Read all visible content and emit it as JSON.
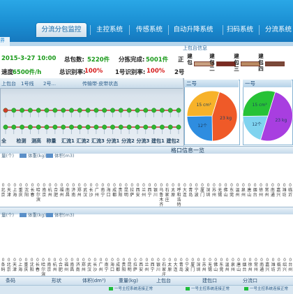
{
  "nav": {
    "tabs": [
      "分流分包监控",
      "主控系统",
      "传感系统",
      "自动升降系统",
      "扫码系统",
      "分流系统"
    ],
    "active_index": 0,
    "left_fragment": "界"
  },
  "stats": {
    "date": "2015-3-27 10:00",
    "total_label": "总包数:",
    "total_value": "5220件",
    "done_label": "分拣完成:",
    "done_value": "5001件",
    "speed_label": "速度",
    "speed_value": "6500件/h",
    "total_rate_label": "总识别率:",
    "total_rate_value": "100%",
    "one_rate_label": "1号识别率:",
    "one_rate_value": "100%",
    "right_frag1": "正",
    "right_frag2": "2号"
  },
  "upper_legend": {
    "head": "上包台信息",
    "labels": [
      "建包",
      "建包二",
      "建包三",
      "建包四"
    ],
    "colors": [
      "#c8a080",
      "#7a2b22",
      "#b98a62",
      "#7a4a3a"
    ]
  },
  "conveyor": {
    "tab_items": [
      "上包台",
      "1号线",
      "2号...",
      "传输带·皮带状态"
    ],
    "lane_labels": [
      "全",
      "检测",
      "测高",
      "称量",
      "汇流1",
      "汇流2",
      "汇流3",
      "分流1",
      "分流2",
      "分流3",
      "建包1",
      "建包2"
    ]
  },
  "pies": [
    {
      "title": "二号",
      "slices": [
        {
          "label": "23 kg",
          "value": 45,
          "color": "#ef5a28"
        },
        {
          "label": "12个",
          "value": 25,
          "color": "#2e8de0"
        },
        {
          "label": "15 cm³",
          "value": 30,
          "color": "#f7b22a"
        }
      ]
    },
    {
      "title": "一号",
      "slices": [
        {
          "label": "23 kg",
          "value": 50,
          "color": "#a83ee0"
        },
        {
          "label": "12个",
          "value": 20,
          "color": "#7fd3ef"
        },
        {
          "label": "15 cm³",
          "value": 30,
          "color": "#27c236"
        }
      ]
    }
  ],
  "panel1": {
    "header": "格口信息一览",
    "legend": [
      "量(个)",
      "体重(kg)",
      "体积(m3)"
    ],
    "columns": [
      "北京",
      "天津",
      "上海",
      "重庆",
      "沈阳",
      "长春",
      "哈尔滨",
      "南京",
      "杭州",
      "合肥",
      "福州",
      "南昌",
      "济南",
      "郑州",
      "武汉",
      "长沙",
      "广州",
      "南宁",
      "海口",
      "成都",
      "贵阳",
      "昆明",
      "拉萨",
      "西安",
      "兰州",
      "西宁",
      "银川",
      "乌鲁木齐",
      "石家庄",
      "太原",
      "呼和浩特",
      "大连",
      "青岛",
      "宁波",
      "厦门",
      "深圳",
      "苏州",
      "无锡",
      "佛山",
      "东莞",
      "温州",
      "泉州",
      "唐山",
      "烟台",
      "徐州",
      "常州",
      "南通",
      "嘉兴",
      "潍坊",
      "临沂"
    ]
  },
  "panel2": {
    "legend": [
      "量(个)",
      "体重(kg)",
      "体积(m3)"
    ],
    "columns": [
      "条码",
      "北京",
      "天津",
      "上海",
      "重庆",
      "沈阳",
      "长春",
      "哈尔滨",
      "南京",
      "杭州",
      "合肥",
      "福州",
      "南昌",
      "济南",
      "郑州",
      "武汉",
      "长沙",
      "广州",
      "南宁",
      "海口",
      "成都",
      "贵阳",
      "昆明",
      "拉萨",
      "西安",
      "兰州",
      "西宁",
      "银川",
      "石家庄",
      "太原",
      "大连",
      "青岛",
      "宁波",
      "厦门",
      "深圳",
      "苏州",
      "无锡",
      "佛山",
      "东莞",
      "温州",
      "泉州",
      "唐山",
      "烟台",
      "徐州",
      "常州",
      "南通",
      "嘉兴",
      "潍坊",
      "临沂",
      "绍兴",
      "台州"
    ]
  },
  "table": {
    "headers": [
      "条码",
      "形状",
      "体积(dm³)",
      "重量(kg)",
      "上包台",
      "建包口",
      "分流口"
    ]
  },
  "status": {
    "items": [
      "一号主控系统连接正常",
      "一号主控系统连接正常",
      "一号主控系统连接正常"
    ]
  }
}
